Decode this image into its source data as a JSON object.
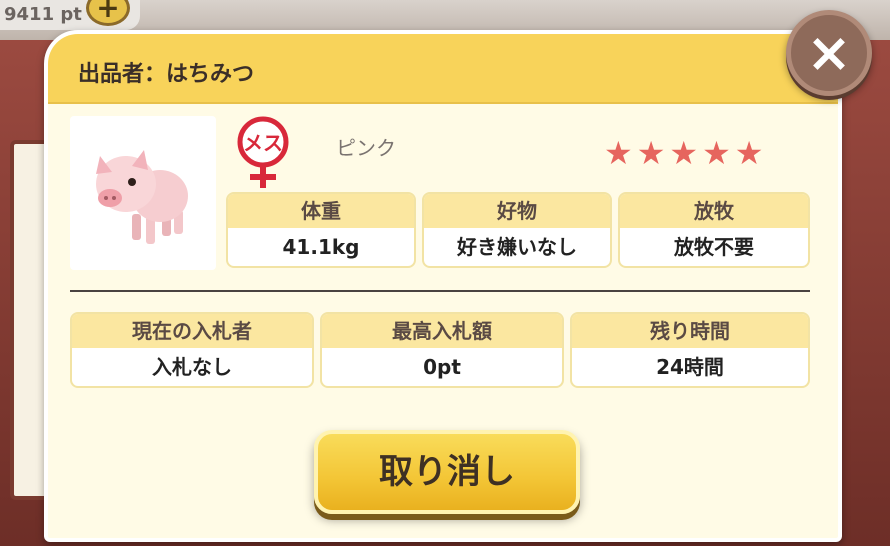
{
  "background": {
    "points": "9411 pt",
    "plus": "+"
  },
  "dialog": {
    "title": "出品者：はちみつ",
    "close": "×"
  },
  "pig": {
    "gender": "メス",
    "color": "ピンク",
    "stars": "★★★★★",
    "rating": 5
  },
  "stats": [
    {
      "label": "体重",
      "value": "41.1kg"
    },
    {
      "label": "好物",
      "value": "好き嫌いなし"
    },
    {
      "label": "放牧",
      "value": "放牧不要"
    }
  ],
  "auction": [
    {
      "label": "現在の入札者",
      "value": "入札なし"
    },
    {
      "label": "最高入札額",
      "value": "0pt"
    },
    {
      "label": "残り時間",
      "value": "24時間"
    }
  ],
  "cancel_label": "取り消し",
  "colors": {
    "header": "#f8d35a",
    "panel": "#fffbe6",
    "star": "#e6655e",
    "gender": "#d8283a",
    "button": "#f3c535"
  }
}
